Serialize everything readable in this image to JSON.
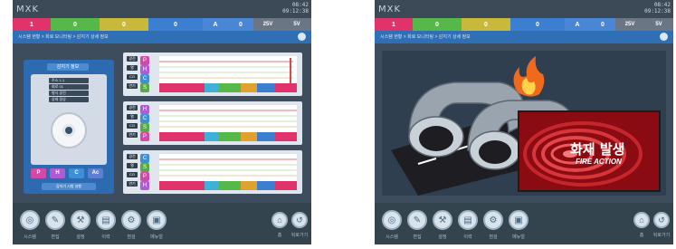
{
  "app": {
    "logo": "MXK",
    "clock_top": "08:42",
    "clock_bottom": "09:12:38"
  },
  "status_segments": [
    {
      "label": "1",
      "color": "#e0336b"
    },
    {
      "label": "0",
      "color": "#57b84a"
    },
    {
      "label": "0",
      "color": "#c8b93a"
    },
    {
      "label": "0",
      "color": "#3b7fd0"
    },
    {
      "label": "A",
      "color": "#4a86d6"
    },
    {
      "label": "0",
      "color": "#4a86d6"
    },
    {
      "label": "25V",
      "color": "#6a7684"
    },
    {
      "label": "5V",
      "color": "#6a7684"
    }
  ],
  "breadcrumb": "시스템 현황 > 회로 모니터링 > 감지기 상세 정보",
  "bottom_buttons": [
    "시스템",
    "편집",
    "설정",
    "이력",
    "점검",
    "메뉴얼"
  ],
  "bottom_right": [
    "홈",
    "뒤로가기"
  ],
  "detector": {
    "title": "감지기 정보",
    "rows": [
      "주소 1-1",
      "회로 01",
      "형식 광전",
      "상태 정상"
    ],
    "tiles": [
      {
        "label": "P",
        "color": "#d24aa8"
      },
      {
        "label": "H",
        "color": "#b05bd6"
      },
      {
        "label": "C",
        "color": "#3f8fd8"
      },
      {
        "label": "Ac",
        "color": "#5d7fd2"
      }
    ],
    "action_button": "감지기 시험 실행"
  },
  "charts": [
    {
      "labels": [
        "광전",
        "열",
        "CO",
        "연기"
      ],
      "badges": [
        "P",
        "H",
        "C",
        "S"
      ],
      "badge_colors": [
        "#d24aa8",
        "#b05bd6",
        "#3f8fd8",
        "#5aa84a"
      ]
    },
    {
      "labels": [
        "광전",
        "열",
        "CO",
        "연기"
      ],
      "badges": [
        "H",
        "C",
        "S",
        "P"
      ],
      "badge_colors": [
        "#b05bd6",
        "#3f8fd8",
        "#5aa84a",
        "#d24aa8"
      ]
    },
    {
      "labels": [
        "광전",
        "열",
        "CO",
        "연기"
      ],
      "badges": [
        "C",
        "S",
        "P",
        "H"
      ],
      "badge_colors": [
        "#3f8fd8",
        "#5aa84a",
        "#d24aa8",
        "#b05bd6"
      ]
    }
  ],
  "fire_alarm": {
    "title_kr": "화재 발생",
    "title_en": "FIRE ACTION"
  }
}
